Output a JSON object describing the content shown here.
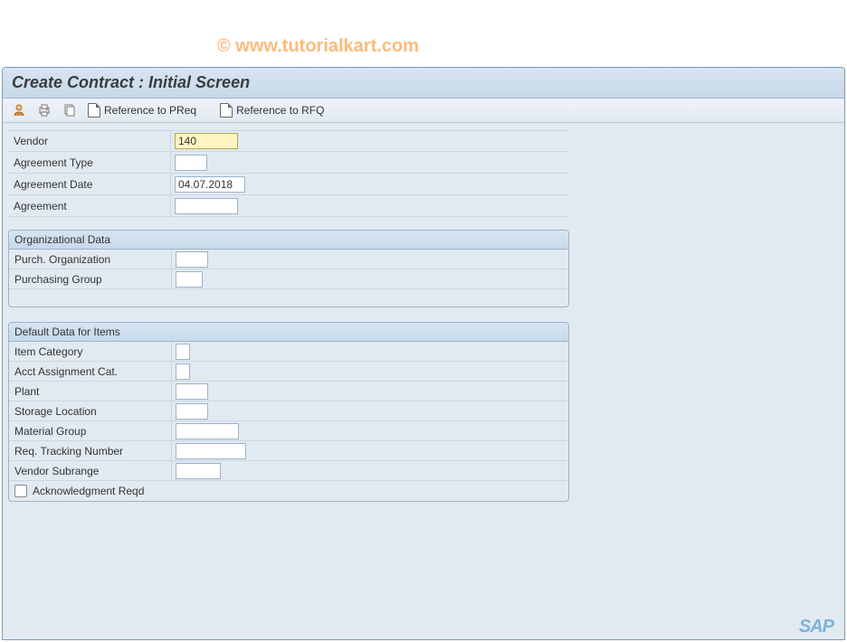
{
  "watermark": "© www.tutorialkart.com",
  "header": {
    "title": "Create Contract : Initial Screen"
  },
  "toolbar": {
    "ref_preq": "Reference to PReq",
    "ref_rfq": "Reference to RFQ"
  },
  "fields": {
    "vendor_label": "Vendor",
    "vendor_value": "140",
    "agreement_type_label": "Agreement Type",
    "agreement_type_value": "",
    "agreement_date_label": "Agreement Date",
    "agreement_date_value": "04.07.2018",
    "agreement_label": "Agreement",
    "agreement_value": ""
  },
  "org_data": {
    "title": "Organizational Data",
    "purch_org_label": "Purch. Organization",
    "purch_org_value": "",
    "purch_group_label": "Purchasing Group",
    "purch_group_value": ""
  },
  "default_data": {
    "title": "Default Data for Items",
    "item_category_label": "Item Category",
    "item_category_value": "",
    "acct_assign_label": "Acct Assignment Cat.",
    "acct_assign_value": "",
    "plant_label": "Plant",
    "plant_value": "",
    "storage_loc_label": "Storage Location",
    "storage_loc_value": "",
    "material_group_label": "Material Group",
    "material_group_value": "",
    "req_tracking_label": "Req. Tracking Number",
    "req_tracking_value": "",
    "vendor_subrange_label": "Vendor Subrange",
    "vendor_subrange_value": "",
    "ack_reqd_label": "Acknowledgment Reqd"
  },
  "logo": "SAP"
}
